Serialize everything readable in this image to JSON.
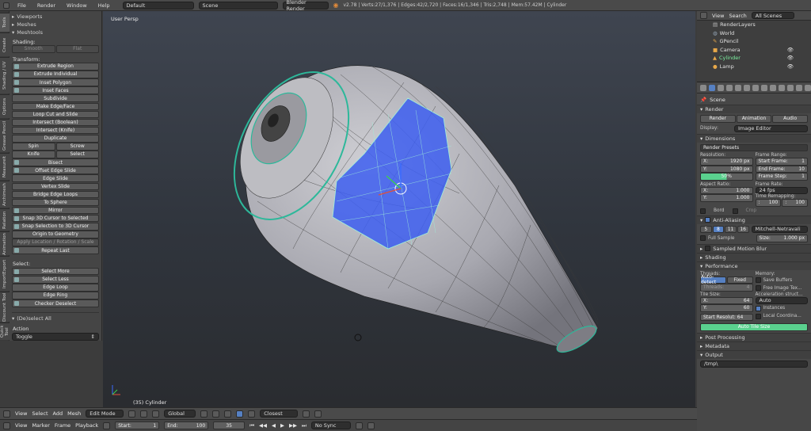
{
  "topbar": {
    "menus": [
      "File",
      "Render",
      "Window",
      "Help"
    ],
    "layout": "Default",
    "scene": "Scene",
    "engine": "Blender Render",
    "stats": "v2.78 | Verts:27/1,376 | Edges:42/2,720 | Faces:16/1,346 | Tris:2,748 | Mem:57.42M | Cylinder"
  },
  "tabs": [
    "Tools",
    "Create",
    "Shading / UV",
    "Options",
    "Grease Pencil",
    "Measureit",
    "Archimesh",
    "Relation",
    "Animation",
    "ImportExport",
    "Discount Tool",
    "Quick Tool"
  ],
  "tools": {
    "viewports": "Viewports",
    "meshes": "Meshes",
    "meshtools": "Meshtools",
    "shading": "Shading:",
    "smooth": "Smooth",
    "flat": "Flat",
    "transform": "Transform:",
    "buttons": [
      "Extrude Region",
      "Extrude Individual",
      "Inset Polygon",
      "Inset Faces",
      "Subdivide",
      "Make Edge/Face",
      "Loop Cut and Slide",
      "Intersect (Boolean)",
      "Intersect (Knife)",
      "Duplicate"
    ],
    "spin": "Spin",
    "screw": "Screw",
    "knife": "Knife",
    "select": "Select",
    "buttons2": [
      "Bisect",
      "Offset Edge Slide",
      "Edge Slide",
      "Vertex Slide",
      "Bridge Edge Loops",
      "To Sphere",
      "Mirror",
      "Snap 3D Cursor to Selected",
      "Snap Selection to 3D Cursor",
      "Origin to Geometry"
    ],
    "apply": "Apply Location / Rotation / Scale",
    "repeat": "Repeat Last",
    "select_label": "Select:",
    "select_buttons": [
      "Select More",
      "Select Less",
      "Edge Loop",
      "Edge Ring",
      "Checker Deselect"
    ],
    "operator": "(De)select All",
    "action_label": "Action",
    "action_value": "Toggle"
  },
  "viewport": {
    "persp": "User Persp",
    "object": "(35) Cylinder"
  },
  "outliner": {
    "view": "View",
    "search": "Search",
    "scenes": "All Scenes",
    "items": [
      "RenderLayers",
      "World",
      "GPencil",
      "Camera",
      "Cylinder",
      "Lamp"
    ]
  },
  "props": {
    "scene": "Scene",
    "render": "Render",
    "render_btn": "Render",
    "anim_btn": "Animation",
    "audio_btn": "Audio",
    "display_label": "Display:",
    "display_value": "Image Editor",
    "dimensions": "Dimensions",
    "presets": "Render Presets",
    "resolution": "Resolution:",
    "res_x": "1920 px",
    "res_y": "1080 px",
    "res_pct": "50%",
    "frame_range": "Frame Range:",
    "start_frame": "1",
    "end_frame": "10",
    "frame_step": "1",
    "aspect": "Aspect Ratio:",
    "aspect_x": "1.000",
    "aspect_y": "1.000",
    "frame_rate": "Frame Rate:",
    "fps": "24 fps",
    "remap": "Time Remapping:",
    "remap_old": "100",
    "remap_new": "100",
    "bord": "Bord",
    "crop": "Crop",
    "aa": "Anti-Aliasing",
    "aa_values": [
      "5",
      "8",
      "11",
      "16"
    ],
    "filter": "Mitchell-Netravali",
    "full_sample": "Full Sample",
    "size_label": "Size:",
    "size_value": "1.000 px",
    "motion_blur": "Sampled Motion Blur",
    "shading": "Shading",
    "performance": "Performance",
    "threads": "Threads:",
    "memory": "Memory:",
    "auto_detect": "Auto-detect",
    "fixed": "Fixed",
    "threads_val": "4",
    "save_buffers": "Save Buffers",
    "free_image": "Free Image Tex...",
    "tile_size": "Tile Size:",
    "tile_x": "64",
    "tile_y": "60",
    "accel": "Acceleration struct...",
    "accel_val": "Auto",
    "instances": "Instances",
    "local_coord": "Local Coordina...",
    "start_res": "Start Resolut: 64",
    "auto_tile": "Auto Tile Size",
    "post": "Post Processing",
    "metadata": "Metadata",
    "output": "Output",
    "output_path": "/tmp\\"
  },
  "bottom": {
    "view": "View",
    "select": "Select",
    "add": "Add",
    "mesh": "Mesh",
    "mode": "Edit Mode",
    "pivot": "Global",
    "snap": "Closest",
    "marker": "Marker",
    "frame": "Frame",
    "playback": "Playback",
    "start_label": "Start:",
    "start": "1",
    "end_label": "End:",
    "end": "100",
    "current": "35",
    "sync": "No Sync"
  }
}
